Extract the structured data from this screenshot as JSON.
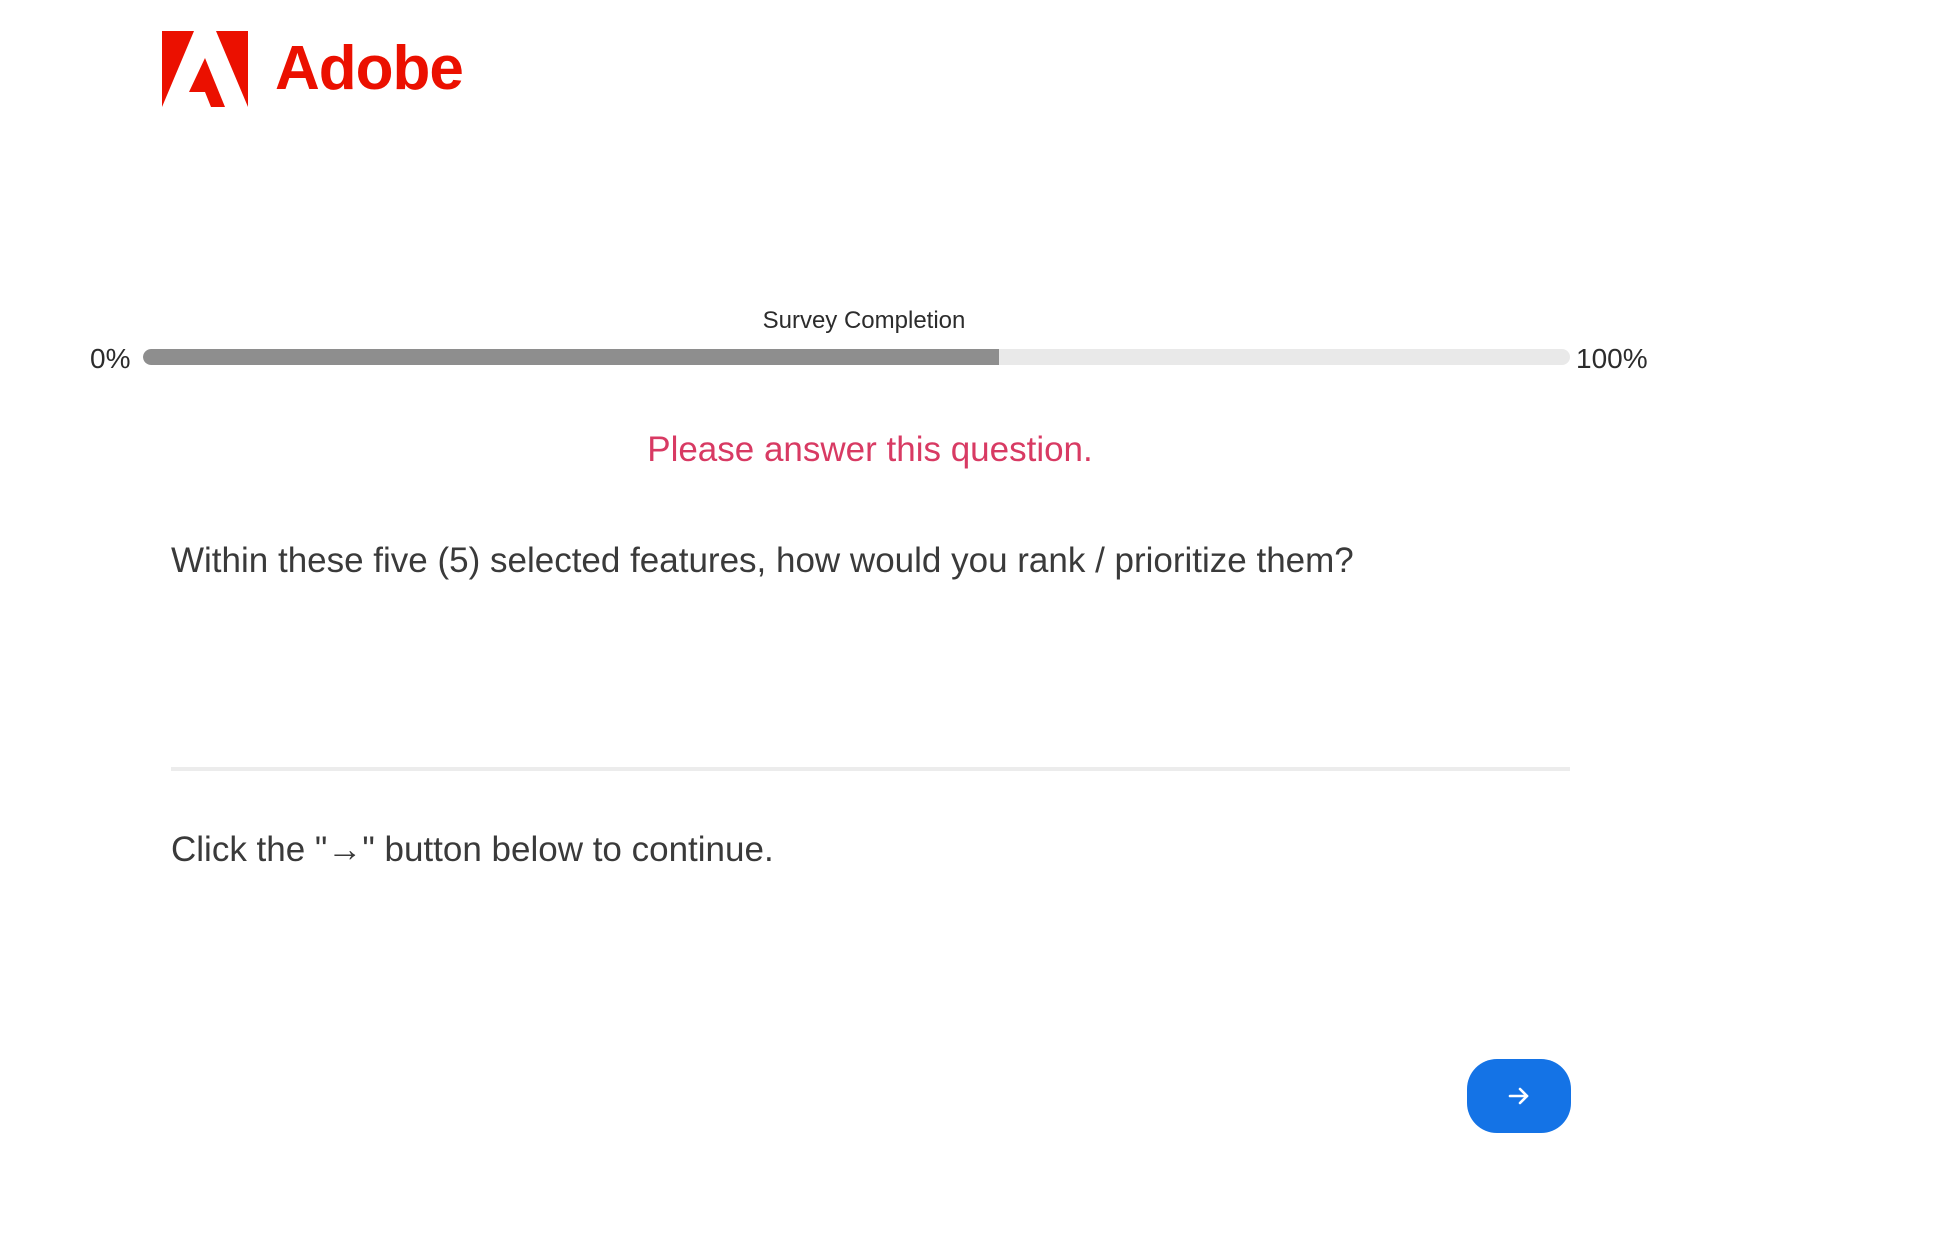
{
  "header": {
    "logo_text": "Adobe",
    "logo_icon": "adobe-logo-icon",
    "brand_color": "#eb1000"
  },
  "progress": {
    "title": "Survey Completion",
    "min_label": "0%",
    "max_label": "100%",
    "value_percent": 60,
    "fill_color": "#8e8e8e"
  },
  "validation": {
    "message": "Please answer this question.",
    "color": "#d83a63"
  },
  "question": {
    "text": "Within these five (5) selected features, how would you rank / prioritize them?"
  },
  "instruction": {
    "text": "Click the \"→\" button below to continue."
  },
  "navigation": {
    "next_icon": "arrow-right-icon",
    "next_color": "#1473e6"
  }
}
